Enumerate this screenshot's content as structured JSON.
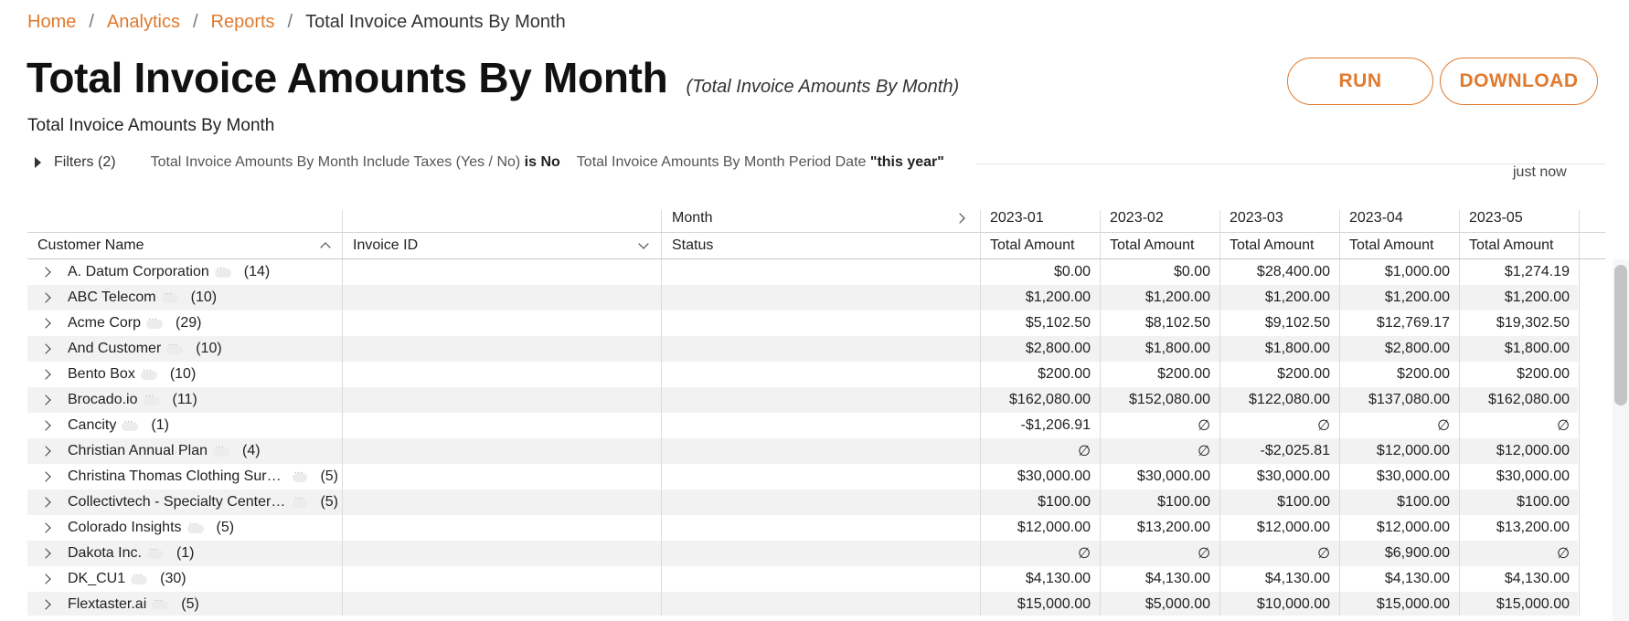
{
  "breadcrumb": {
    "home": "Home",
    "analytics": "Analytics",
    "reports": "Reports",
    "current": "Total Invoice Amounts By Month"
  },
  "header": {
    "title": "Total Invoice Amounts By Month",
    "subtitle": "(Total Invoice Amounts By Month)"
  },
  "actions": {
    "run": "RUN",
    "download": "DOWNLOAD"
  },
  "description": "Total Invoice Amounts By Month",
  "filters": {
    "toggle": "Filters (2)",
    "items": [
      {
        "field": "Total Invoice Amounts By Month Include Taxes (Yes / No)",
        "op": "is No"
      },
      {
        "field": "Total Invoice Amounts By Month Period Date",
        "op": "\"this year\""
      }
    ]
  },
  "timestamp": "just now",
  "table": {
    "pivot_label": "Month",
    "columns": {
      "customer": "Customer Name",
      "invoice": "Invoice ID",
      "status": "Status"
    },
    "months": [
      "2023-01",
      "2023-02",
      "2023-03",
      "2023-04",
      "2023-05"
    ],
    "measure": "Total Amount",
    "rows": [
      {
        "name": "A. Datum Corporation",
        "count": "(14)",
        "values": [
          "$0.00",
          "$0.00",
          "$28,400.00",
          "$1,000.00",
          "$1,274.19"
        ]
      },
      {
        "name": "ABC Telecom",
        "count": "(10)",
        "values": [
          "$1,200.00",
          "$1,200.00",
          "$1,200.00",
          "$1,200.00",
          "$1,200.00"
        ]
      },
      {
        "name": "Acme Corp",
        "count": "(29)",
        "values": [
          "$5,102.50",
          "$8,102.50",
          "$9,102.50",
          "$12,769.17",
          "$19,302.50"
        ]
      },
      {
        "name": "And Customer",
        "count": "(10)",
        "values": [
          "$2,800.00",
          "$1,800.00",
          "$1,800.00",
          "$2,800.00",
          "$1,800.00"
        ]
      },
      {
        "name": "Bento Box",
        "count": "(10)",
        "values": [
          "$200.00",
          "$200.00",
          "$200.00",
          "$200.00",
          "$200.00"
        ]
      },
      {
        "name": "Brocado.io",
        "count": "(11)",
        "values": [
          "$162,080.00",
          "$152,080.00",
          "$122,080.00",
          "$137,080.00",
          "$162,080.00"
        ]
      },
      {
        "name": "Cancity",
        "count": "(1)",
        "values": [
          "-$1,206.91",
          "∅",
          "∅",
          "∅",
          "∅"
        ]
      },
      {
        "name": "Christian Annual Plan",
        "count": "(4)",
        "values": [
          "∅",
          "∅",
          "-$2,025.81",
          "$12,000.00",
          "$12,000.00"
        ]
      },
      {
        "name": "Christina Thomas Clothing Surplu…",
        "count": "(5)",
        "values": [
          "$30,000.00",
          "$30,000.00",
          "$30,000.00",
          "$30,000.00",
          "$30,000.00"
        ]
      },
      {
        "name": "Collectivtech - Specialty Center AB…",
        "count": "(5)",
        "values": [
          "$100.00",
          "$100.00",
          "$100.00",
          "$100.00",
          "$100.00"
        ]
      },
      {
        "name": "Colorado Insights",
        "count": "(5)",
        "values": [
          "$12,000.00",
          "$13,200.00",
          "$12,000.00",
          "$12,000.00",
          "$13,200.00"
        ]
      },
      {
        "name": "Dakota Inc.",
        "count": "(1)",
        "values": [
          "∅",
          "∅",
          "∅",
          "$6,900.00",
          "∅"
        ]
      },
      {
        "name": "DK_CU1",
        "count": "(30)",
        "values": [
          "$4,130.00",
          "$4,130.00",
          "$4,130.00",
          "$4,130.00",
          "$4,130.00"
        ]
      },
      {
        "name": "Flextaster.ai",
        "count": "(5)",
        "values": [
          "$15,000.00",
          "$5,000.00",
          "$10,000.00",
          "$15,000.00",
          "$15,000.00"
        ]
      }
    ]
  },
  "colors": {
    "accent": "#e07a2e",
    "row_alt": "#f2f2f2"
  }
}
